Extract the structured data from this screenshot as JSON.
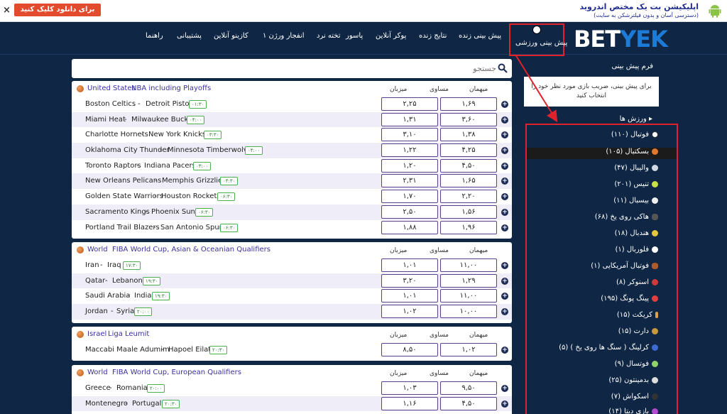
{
  "topbar": {
    "button_label": "برای دانلود کلیک کنید",
    "title": "اپلیکیشن بت یک مختص اندروید",
    "subtitle": "(دسترسی آسان و بدون فیلترشکن به سایت)",
    "close_glyph": "×"
  },
  "nav": {
    "logo_main": "BET",
    "logo_accent": "YEK",
    "items": [
      "پیش بینی ورزشی",
      "پیش بینی زنده",
      "نتایج زنده",
      "پوکر آنلاین",
      "پاسور",
      "تخته نرد",
      "انفجار ورژن ۱",
      "کازینو آنلاین",
      "پشتیبانی",
      "راهنما"
    ]
  },
  "search": {
    "placeholder": "جستجو"
  },
  "columns": {
    "home": "میهمان",
    "draw": "مساوی",
    "away": "میزبان"
  },
  "blocks": [
    {
      "country": "United States",
      "league": "NBA including Playoffs",
      "rows": [
        {
          "home": "Boston Celtics",
          "away": "Detroit Pistons",
          "time": "۰۱:۳۰",
          "o1": "۲,۲۵",
          "o2": "۱,۶۹"
        },
        {
          "home": "Miami Heat",
          "away": "Milwaukee Bucks",
          "time": "۰۴:۰۰",
          "o1": "۱,۳۱",
          "o2": "۳,۶۰"
        },
        {
          "home": "Charlotte Hornets",
          "away": "New York Knicks",
          "time": "۰۳:۳۰",
          "o1": "۳,۱۰",
          "o2": "۱,۳۸"
        },
        {
          "home": "Oklahoma City Thunder",
          "away": "Minnesota Timberwolves",
          "time": "۰۴:۰۰",
          "o1": "۱,۲۲",
          "o2": "۴,۲۵"
        },
        {
          "home": "Toronto Raptors",
          "away": "Indiana Pacers",
          "time": "۰۳:۰۰",
          "o1": "۱,۲۰",
          "o2": "۴,۵۰"
        },
        {
          "home": "New Orleans Pelicans",
          "away": "Memphis Grizzlies",
          "time": "۰۴:۳۰",
          "o1": "۲,۳۱",
          "o2": "۱,۶۵"
        },
        {
          "home": "Golden State Warriors",
          "away": "Houston Rockets",
          "time": "۰۶:۳۰",
          "o1": "۱,۷۰",
          "o2": "۲,۲۰"
        },
        {
          "home": "Sacramento Kings",
          "away": "Phoenix Suns",
          "time": "۰۶:۳۰",
          "o1": "۲,۵۰",
          "o2": "۱,۵۶"
        },
        {
          "home": "Portland Trail Blazers",
          "away": "San Antonio Spurs",
          "time": "۰۶:۳۰",
          "o1": "۱,۸۸",
          "o2": "۱,۹۶"
        }
      ]
    },
    {
      "country": "World",
      "league": "FIBA World Cup, Asian & Oceanian Qualifiers",
      "rows": [
        {
          "home": "Iran",
          "away": "Iraq",
          "time": "۱۷:۳۰",
          "o1": "۱,۰۱",
          "o2": "۱۱,۰۰"
        },
        {
          "home": "Qatar",
          "away": "Lebanon",
          "time": "۱۹:۳۰",
          "o1": "۳,۲۰",
          "o2": "۱,۲۹"
        },
        {
          "home": "Saudi Arabia",
          "away": "India",
          "time": "۱۹:۳۰",
          "o1": "۱,۰۱",
          "o2": "۱۱,۰۰"
        },
        {
          "home": "Jordan",
          "away": "Syria",
          "time": "۲۰:۰۰",
          "o1": "۱,۰۲",
          "o2": "۱۰,۰۰"
        }
      ]
    },
    {
      "country": "Israel",
      "league": "Liga Leumit",
      "rows": [
        {
          "home": "Maccabi Maale Adumim",
          "away": "Hapoel Eilat",
          "time": "۲۰:۳۰",
          "o1": "۸,۵۰",
          "o2": "۱,۰۲"
        }
      ]
    },
    {
      "country": "World",
      "league": "FIBA World Cup, European Qualifiers",
      "rows": [
        {
          "home": "Greece",
          "away": "Romania",
          "time": "۲۰:۰۰",
          "o1": "۱,۰۳",
          "o2": "۹,۵۰"
        },
        {
          "home": "Montenegro",
          "away": "Portugal",
          "time": "۲۰:۳۰",
          "o1": "۱,۱۶",
          "o2": "۴,۵۰"
        }
      ]
    }
  ],
  "sidebar": {
    "form_title": "فرم پیش بینی",
    "form_text": "برای پیش بینی، ضریب بازی مورد نظر خود را انتخاب کنید",
    "sports_title": "ورزش ها",
    "sports": [
      {
        "label": "فوتبال (۱۱۰)",
        "color": "#ffffff"
      },
      {
        "label": "بسکتبال (۱۰۵)",
        "color": "#e0782e",
        "active": true
      },
      {
        "label": "والیبال (۴۷)",
        "color": "#cfd8e3"
      },
      {
        "label": "تنیس (۲۰۱)",
        "color": "#c8e04a"
      },
      {
        "label": "بیسبال (۱۱)",
        "color": "#f0f0f0"
      },
      {
        "label": "هاکی روی یخ (۶۸)",
        "color": "#444444"
      },
      {
        "label": "هندبال (۱۸)",
        "color": "#e6c63a"
      },
      {
        "label": "فلوربال (۱)",
        "color": "#ffffff"
      },
      {
        "label": "فوتبال آمریکایی (۱)",
        "color": "#b05a2a"
      },
      {
        "label": "اسنوکر (۸)",
        "color": "#d23a3a"
      },
      {
        "label": "پینگ پونگ (۱۹۵)",
        "color": "#e04040"
      },
      {
        "label": "کریکت (۱۵)",
        "color": "#d9a441"
      },
      {
        "label": "دارت (۱۵)",
        "color": "#c99a3a"
      },
      {
        "label": "کرلینگ ( سنگ ها روی یخ ) (۵)",
        "color": "#3a6ad2"
      },
      {
        "label": "فوتسال (۹)",
        "color": "#8fd36b"
      },
      {
        "label": "بدمینتون (۲۵)",
        "color": "#dddddd"
      },
      {
        "label": "اسکواش (۷)",
        "color": "#333333"
      },
      {
        "label": "بازی دیتا (۱۴)",
        "color": "#b44ad2"
      }
    ]
  }
}
